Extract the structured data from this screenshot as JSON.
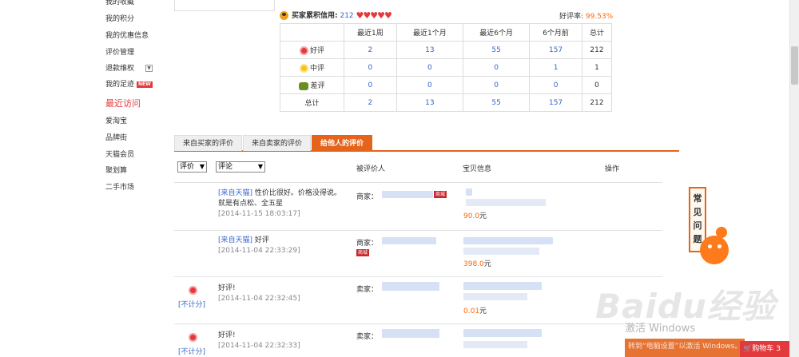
{
  "sidebar": {
    "items_top": [
      {
        "label": "我的积分"
      },
      {
        "label": "我的优惠信息"
      },
      {
        "label": "评价管理"
      },
      {
        "label": "退款维权"
      },
      {
        "label": "我的足迹",
        "badge": "NEW"
      }
    ],
    "partial_top": "我的收藏",
    "recent_heading": "最近访问",
    "recent_items": [
      {
        "label": "爱淘宝"
      },
      {
        "label": "品牌街"
      },
      {
        "label": "天猫会员"
      },
      {
        "label": "聚划算"
      },
      {
        "label": "二手市场"
      }
    ]
  },
  "credit": {
    "label": "买家累积信用:",
    "score": "212",
    "rate_label": "好评率:",
    "rate_value": "99.53%"
  },
  "stats": {
    "headers": [
      "",
      "最近1周",
      "最近1个月",
      "最近6个月",
      "6个月前",
      "总计"
    ],
    "rows": [
      {
        "label": "好评",
        "icon": "red-flower-icon",
        "values": [
          "2",
          "13",
          "55",
          "157",
          "212"
        ]
      },
      {
        "label": "中评",
        "icon": "yellow-flower-icon",
        "values": [
          "0",
          "0",
          "0",
          "1",
          "1"
        ]
      },
      {
        "label": "差评",
        "icon": "green-leaf-icon",
        "values": [
          "0",
          "0",
          "0",
          "0",
          "0"
        ]
      },
      {
        "label": "总计",
        "icon": "",
        "values": [
          "2",
          "13",
          "55",
          "157",
          "212"
        ]
      }
    ]
  },
  "tabs": [
    {
      "label": "来自买家的评价",
      "active": false
    },
    {
      "label": "来自卖家的评价",
      "active": false
    },
    {
      "label": "给他人的评价",
      "active": true
    }
  ],
  "filters": {
    "rating_select": "评价",
    "comment_select": "评论"
  },
  "columns": {
    "target": "被评价人",
    "item": "宝贝信息",
    "action": "操作"
  },
  "reviews": [
    {
      "source": "[来自天猫]",
      "text": "性价比很好。价格没得说。就是有点松、全五星",
      "date": "[2014-11-15 18:03:17]",
      "role": "商家：",
      "badge": "商城",
      "price": "90.0",
      "unit": "元"
    },
    {
      "source": "[来自天猫]",
      "text": "好评",
      "date": "[2014-11-04 22:33:29]",
      "role": "商家：",
      "badge": "商城",
      "price": "398.0",
      "unit": "元"
    },
    {
      "source": "",
      "text": "好评!",
      "date": "[2014-11-04 22:32:45]",
      "role": "卖家：",
      "badge": "",
      "price": "0.01",
      "unit": "元",
      "nocount": "[不计分]"
    },
    {
      "source": "",
      "text": "好评!",
      "date": "[2014-11-04 22:32:33]",
      "role": "卖家：",
      "badge": "",
      "price": "",
      "unit": "",
      "nocount": "[不计分]"
    }
  ],
  "faq": {
    "label": "常见问题"
  },
  "cart": {
    "label": "购物车",
    "count": "3"
  },
  "system_notice": {
    "title": "激活 Windows",
    "subtitle": "转到“电脑设置”以激活 Windows。"
  },
  "watermark": "Baidu经验"
}
